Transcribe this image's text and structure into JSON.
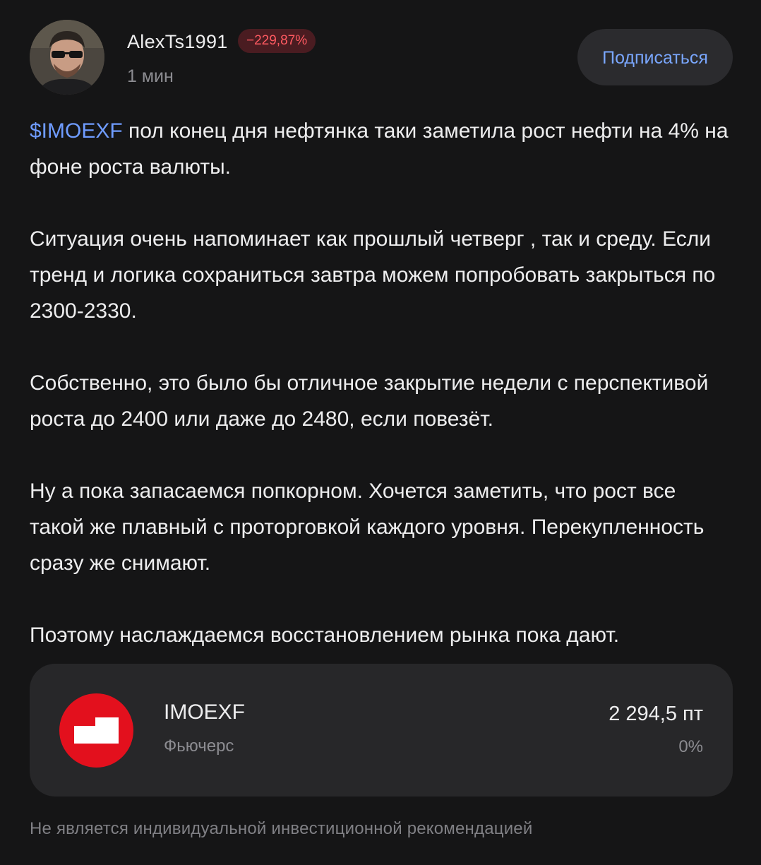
{
  "post": {
    "author": {
      "name": "AlexTs1991",
      "yield_badge": "−229,87%",
      "time": "1 мин"
    },
    "subscribe_label": "Подписаться",
    "body": {
      "ticker_link": "$IMOEXF",
      "p1_text": " пол конец дня нефтянка таки заметила рост нефти на 4% на фоне роста валюты.",
      "p2": "Ситуация очень напоминает как прошлый четверг , так и среду. Если тренд и логика сохраниться завтра можем попробовать закрыться по 2300-2330.",
      "p3": "Собственно, это было бы отличное закрытие недели с перспективой роста до 2400 или даже до 2480, если повезёт.",
      "p4": "Ну а пока запасаемся попкорном. Хочется заметить, что рост все такой же плавный с  проторговкой каждого уровня. Перекупленность сразу же снимают.",
      "p5": "Поэтому наслаждаемся восстановлением рынка пока дают."
    },
    "instrument": {
      "ticker": "IMOEXF",
      "type": "Фьючерс",
      "price": "2 294,5 пт",
      "change": "0%",
      "logo_icon": "moex-logo-icon",
      "logo_color": "#e3101d"
    },
    "disclaimer": "Не является индивидуальной инвестиционной рекомендацией"
  },
  "colors": {
    "background": "#151516",
    "accent_link": "#6f9cff",
    "negative": "#ff5a61",
    "card_background": "#272729"
  }
}
